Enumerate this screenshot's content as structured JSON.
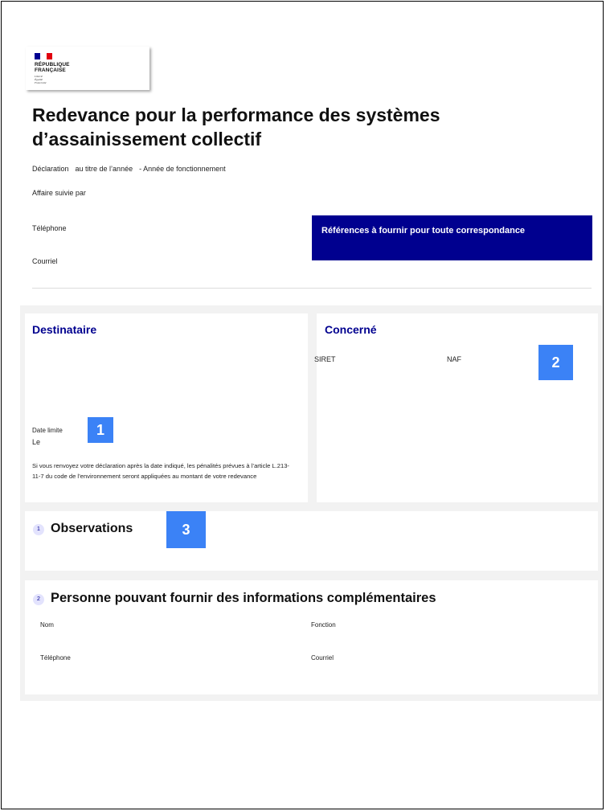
{
  "logo": {
    "flag_colors": [
      "#000091",
      "#ffffff",
      "#e1000f"
    ],
    "name_line1": "RÉPUBLIQUE",
    "name_line2": "FRANÇAISE",
    "motto": [
      "Liberté",
      "Égalité",
      "Fraternité"
    ]
  },
  "header": {
    "title_line1": "Redevance pour la performance des systèmes",
    "title_line2": "d’assainissement collectif",
    "declaration": "Déclaration",
    "year_label": "au titre de l’année",
    "operation_label": "- Année de fonctionnement",
    "affaire_label": "Affaire suivie par",
    "telephone_label": "Téléphone",
    "courriel_label": "Courriel",
    "reference_box": "Références à fournir pour toute correspondance"
  },
  "destinataire": {
    "title": "Destinataire",
    "deadline_label": "Date limite",
    "deadline_le": "Le",
    "penalty_text": "Si vous renvoyez votre déclaration après la date indiqué, les pénalités prévues à l’article L.213-11-7 du code de l’environnement seront appliquées au montant de votre redevance"
  },
  "concerne": {
    "title": "Concerné",
    "siret_label": "SIRET",
    "naf_label": "NAF"
  },
  "observations": {
    "number": "1",
    "title": "Observations"
  },
  "personne": {
    "number": "2",
    "title": "Personne pouvant fournir des informations complémentaires",
    "nom_label": "Nom",
    "fonction_label": "Fonction",
    "telephone_label": "Téléphone",
    "courriel_label": "Courriel"
  },
  "badges": [
    "1",
    "2",
    "3"
  ],
  "colors": {
    "accent": "#00008f",
    "badge": "#3b82f6",
    "section_bg": "#f2f2f2"
  }
}
